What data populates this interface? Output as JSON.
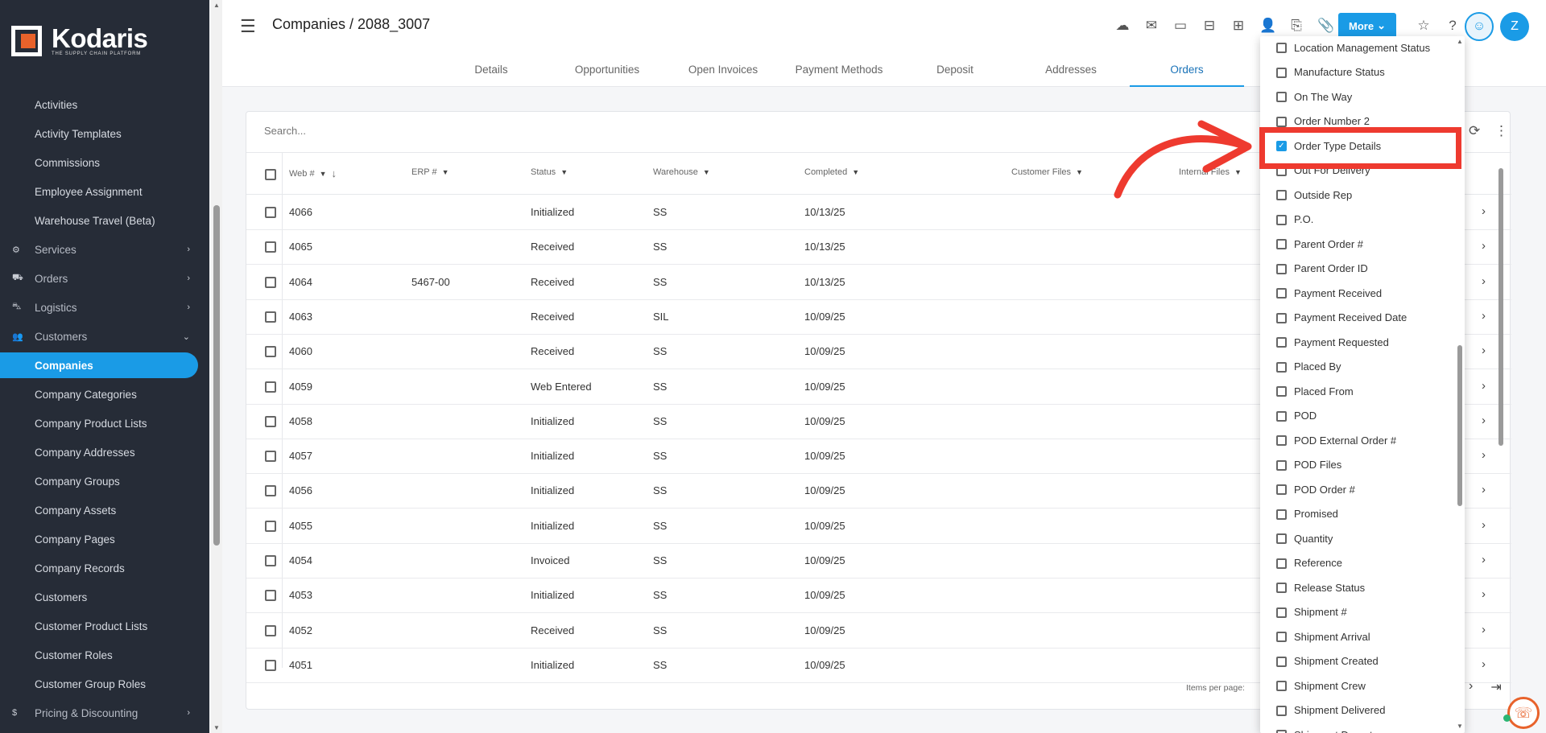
{
  "brand": {
    "name": "Kodaris",
    "tagline": "THE SUPPLY CHAIN PLATFORM",
    "accent": "#e8622b",
    "primary": "#1a9be6"
  },
  "sidebar": {
    "items": [
      {
        "label": "Activities",
        "type": "link"
      },
      {
        "label": "Activity Templates",
        "type": "link"
      },
      {
        "label": "Commissions",
        "type": "link"
      },
      {
        "label": "Employee Assignment",
        "type": "link"
      },
      {
        "label": "Warehouse Travel (Beta)",
        "type": "link"
      },
      {
        "label": "Services",
        "type": "group",
        "icon": "gears-icon"
      },
      {
        "label": "Orders",
        "type": "group",
        "icon": "truck-icon"
      },
      {
        "label": "Logistics",
        "type": "group",
        "icon": "shipping-icon"
      },
      {
        "label": "Customers",
        "type": "group-open",
        "icon": "people-icon"
      },
      {
        "label": "Companies",
        "type": "active"
      },
      {
        "label": "Company Categories",
        "type": "link"
      },
      {
        "label": "Company Product Lists",
        "type": "link"
      },
      {
        "label": "Company Addresses",
        "type": "link"
      },
      {
        "label": "Company Groups",
        "type": "link"
      },
      {
        "label": "Company Assets",
        "type": "link"
      },
      {
        "label": "Company Pages",
        "type": "link"
      },
      {
        "label": "Company Records",
        "type": "link"
      },
      {
        "label": "Customers",
        "type": "link"
      },
      {
        "label": "Customer Product Lists",
        "type": "link"
      },
      {
        "label": "Customer Roles",
        "type": "link"
      },
      {
        "label": "Customer Group Roles",
        "type": "link"
      },
      {
        "label": "Pricing & Discounting",
        "type": "group",
        "icon": "dollar-icon"
      }
    ]
  },
  "header": {
    "title": "Companies / 2088_3007",
    "more_label": "More",
    "avatar_initial": "Z"
  },
  "tabs": [
    "Details",
    "Opportunities",
    "Open Invoices",
    "Payment Methods",
    "Deposit",
    "Addresses",
    "Orders"
  ],
  "table": {
    "search_placeholder": "Search...",
    "columns": [
      "Web #",
      "ERP #",
      "Status",
      "Warehouse",
      "Completed",
      "Customer Files",
      "Internal Files"
    ],
    "rows": [
      {
        "web": "4066",
        "erp": "",
        "status": "Initialized",
        "warehouse": "SS",
        "completed": "10/13/25"
      },
      {
        "web": "4065",
        "erp": "",
        "status": "Received",
        "warehouse": "SS",
        "completed": "10/13/25"
      },
      {
        "web": "4064",
        "erp": "5467-00",
        "status": "Received",
        "warehouse": "SS",
        "completed": "10/13/25"
      },
      {
        "web": "4063",
        "erp": "",
        "status": "Received",
        "warehouse": "SIL",
        "completed": "10/09/25"
      },
      {
        "web": "4060",
        "erp": "",
        "status": "Received",
        "warehouse": "SS",
        "completed": "10/09/25"
      },
      {
        "web": "4059",
        "erp": "",
        "status": "Web Entered",
        "warehouse": "SS",
        "completed": "10/09/25"
      },
      {
        "web": "4058",
        "erp": "",
        "status": "Initialized",
        "warehouse": "SS",
        "completed": "10/09/25"
      },
      {
        "web": "4057",
        "erp": "",
        "status": "Initialized",
        "warehouse": "SS",
        "completed": "10/09/25"
      },
      {
        "web": "4056",
        "erp": "",
        "status": "Initialized",
        "warehouse": "SS",
        "completed": "10/09/25"
      },
      {
        "web": "4055",
        "erp": "",
        "status": "Initialized",
        "warehouse": "SS",
        "completed": "10/09/25"
      },
      {
        "web": "4054",
        "erp": "",
        "status": "Invoiced",
        "warehouse": "SS",
        "completed": "10/09/25"
      },
      {
        "web": "4053",
        "erp": "",
        "status": "Initialized",
        "warehouse": "SS",
        "completed": "10/09/25"
      },
      {
        "web": "4052",
        "erp": "",
        "status": "Received",
        "warehouse": "SS",
        "completed": "10/09/25"
      },
      {
        "web": "4051",
        "erp": "",
        "status": "Initialized",
        "warehouse": "SS",
        "completed": "10/09/25"
      }
    ],
    "items_per_page_label": "Items per page:"
  },
  "column_picker": {
    "options": [
      {
        "label": "Location Management Status",
        "checked": false
      },
      {
        "label": "Manufacture Status",
        "checked": false
      },
      {
        "label": "On The Way",
        "checked": false
      },
      {
        "label": "Order Number 2",
        "checked": false
      },
      {
        "label": "Order Type Details",
        "checked": true
      },
      {
        "label": "Out For Delivery",
        "checked": false
      },
      {
        "label": "Outside Rep",
        "checked": false
      },
      {
        "label": "P.O.",
        "checked": false
      },
      {
        "label": "Parent Order #",
        "checked": false
      },
      {
        "label": "Parent Order ID",
        "checked": false
      },
      {
        "label": "Payment Received",
        "checked": false
      },
      {
        "label": "Payment Received Date",
        "checked": false
      },
      {
        "label": "Payment Requested",
        "checked": false
      },
      {
        "label": "Placed By",
        "checked": false
      },
      {
        "label": "Placed From",
        "checked": false
      },
      {
        "label": "POD",
        "checked": false
      },
      {
        "label": "POD External Order #",
        "checked": false
      },
      {
        "label": "POD Files",
        "checked": false
      },
      {
        "label": "POD Order #",
        "checked": false
      },
      {
        "label": "Promised",
        "checked": false
      },
      {
        "label": "Quantity",
        "checked": false
      },
      {
        "label": "Reference",
        "checked": false
      },
      {
        "label": "Release Status",
        "checked": false
      },
      {
        "label": "Shipment #",
        "checked": false
      },
      {
        "label": "Shipment Arrival",
        "checked": false
      },
      {
        "label": "Shipment Created",
        "checked": false
      },
      {
        "label": "Shipment Crew",
        "checked": false
      },
      {
        "label": "Shipment Delivered",
        "checked": false
      },
      {
        "label": "Shipment Departure",
        "checked": false
      }
    ]
  },
  "annotation": {
    "highlight_color": "#ee3a2f"
  }
}
